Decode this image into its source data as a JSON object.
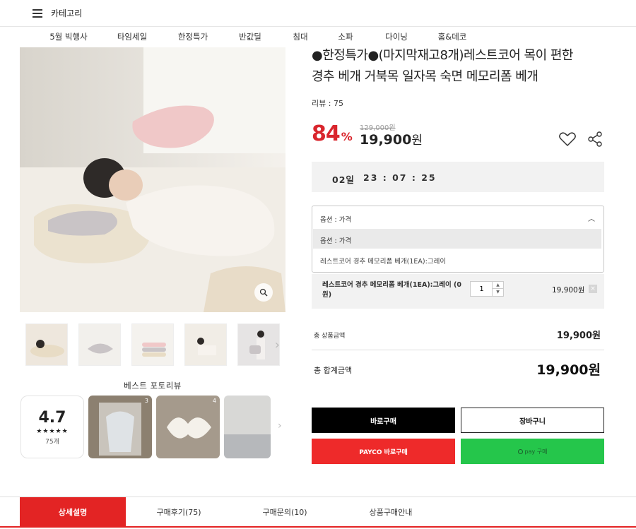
{
  "header": {
    "menu_label": "카테고리"
  },
  "nav": {
    "items": [
      {
        "label": "5월 빅행사"
      },
      {
        "label": "타임세일"
      },
      {
        "label": "한정특가"
      },
      {
        "label": "반값딜"
      },
      {
        "label": "침대"
      },
      {
        "label": "소파"
      },
      {
        "label": "다이닝"
      },
      {
        "label": "홈&데코"
      }
    ]
  },
  "product": {
    "title_line1": "●한정특가●(마지막재고8개)레스트코어 목이 편한",
    "title_line2": "경추 베개 거북목 일자목 숙면 메모리폼 베개",
    "review_count_label": "리뷰 : 75",
    "original_price": "129,000원",
    "discount_num": "84",
    "discount_pct": "%",
    "sale_price_num": "19,900",
    "sale_price_unit": "원"
  },
  "countdown": {
    "days": "02일",
    "time": "23 : 07 : 25"
  },
  "option": {
    "header_label": "옵션 : 가격",
    "rows": [
      {
        "label": "옵션 : 가격"
      },
      {
        "label": "레스트코어 경추 메모리폼 베개(1EA):그레이"
      }
    ]
  },
  "selected": {
    "name": "레스트코어 경추 메모리폼 베개(1EA):그레이 (0원)",
    "quantity": "1",
    "price": "19,900원",
    "remove_label": "×"
  },
  "summary": {
    "subtotal_label": "총 상품금액",
    "subtotal_value": "19,900원",
    "total_label": "총 합계금액",
    "total_value": "19,900원"
  },
  "buttons": {
    "buy": "바로구매",
    "cart": "장바구니",
    "payco": "PAYCO 바로구매",
    "npay": "pay 구매"
  },
  "reviews": {
    "title": "베스트 포토리뷰",
    "score": "4.7",
    "stars": "★★★★★",
    "count": "75개",
    "photos": [
      {
        "badge": "3"
      },
      {
        "badge": "4"
      },
      {
        "badge": ""
      }
    ]
  },
  "tabs": [
    {
      "label": "상세설명"
    },
    {
      "label": "구매후기(75)"
    },
    {
      "label": "구매문의(10)"
    },
    {
      "label": "상품구매안내"
    }
  ],
  "colors": {
    "accent_red": "#e32424",
    "discount_red": "#d9262d",
    "payco_red": "#ee2a2a",
    "npay_green": "#25c64b"
  }
}
